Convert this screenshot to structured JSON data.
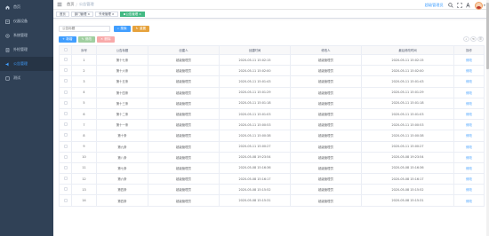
{
  "sidebar": {
    "items": [
      {
        "label": "首页",
        "icon": "dashboard-icon"
      },
      {
        "label": "仪器设备",
        "icon": "instrument-icon"
      },
      {
        "label": "系统管理",
        "icon": "system-icon"
      },
      {
        "label": "外检管理",
        "icon": "inspection-icon"
      },
      {
        "label": "公告管理",
        "icon": "notice-icon",
        "active": true
      },
      {
        "label": "测试",
        "icon": "test-icon"
      }
    ]
  },
  "navbar": {
    "breadcrumb": [
      "首页",
      "公告管理"
    ],
    "username": "超级管理员"
  },
  "tags": [
    {
      "label": "首页"
    },
    {
      "label": "部门管理"
    },
    {
      "label": "外来管理"
    },
    {
      "label": "公告管理",
      "active": true
    }
  ],
  "search": {
    "placeholder": "公告标题",
    "search_label": "搜索",
    "reset_label": "重置"
  },
  "actions": {
    "add_label": "新增",
    "edit_label": "修改",
    "delete_label": "删除"
  },
  "table": {
    "columns": [
      "",
      "序号",
      "公告标题",
      "创建人",
      "创建时间",
      "修改人",
      "最后修改时间",
      "操作"
    ],
    "rows": [
      {
        "no": "1",
        "title": "第十七条",
        "creator": "超级管理员",
        "created": "2020-05-11 15:02:15",
        "modifier": "超级管理员",
        "modified": "2020-05-11 15:02:15",
        "op": "修改"
      },
      {
        "no": "2",
        "title": "第十六条",
        "creator": "超级管理员",
        "created": "2020-05-11 15:02:00",
        "modifier": "超级管理员",
        "modified": "2020-05-11 15:02:00",
        "op": "修改"
      },
      {
        "no": "3",
        "title": "第十五条",
        "creator": "超级管理员",
        "created": "2020-05-11 15:01:43",
        "modifier": "超级管理员",
        "modified": "2020-05-11 15:01:43",
        "op": "修改"
      },
      {
        "no": "4",
        "title": "第十四条",
        "creator": "超级管理员",
        "created": "2020-05-11 15:01:29",
        "modifier": "超级管理员",
        "modified": "2020-05-11 15:01:29",
        "op": "修改"
      },
      {
        "no": "5",
        "title": "第十三条",
        "creator": "超级管理员",
        "created": "2020-05-11 15:01:18",
        "modifier": "超级管理员",
        "modified": "2020-05-11 15:01:18",
        "op": "修改"
      },
      {
        "no": "6",
        "title": "第十二条",
        "creator": "超级管理员",
        "created": "2020-05-11 15:01:03",
        "modifier": "超级管理员",
        "modified": "2020-05-11 15:01:03",
        "op": "修改"
      },
      {
        "no": "7",
        "title": "第十一条",
        "creator": "超级管理员",
        "created": "2020-05-11 15:00:53",
        "modifier": "超级管理员",
        "modified": "2020-05-11 15:00:53",
        "op": "修改"
      },
      {
        "no": "8",
        "title": "第十条",
        "creator": "超级管理员",
        "created": "2020-05-11 15:00:38",
        "modifier": "超级管理员",
        "modified": "2020-05-11 15:00:38",
        "op": "修改"
      },
      {
        "no": "9",
        "title": "第九条",
        "creator": "超级管理员",
        "created": "2020-05-11 15:00:27",
        "modifier": "超级管理员",
        "modified": "2020-05-11 15:00:27",
        "op": "修改"
      },
      {
        "no": "10",
        "title": "第八条",
        "creator": "超级管理员",
        "created": "2020-05-08 19:23:54",
        "modifier": "超级管理员",
        "modified": "2020-05-08 19:23:54",
        "op": "修改"
      },
      {
        "no": "11",
        "title": "第七条",
        "creator": "超级管理员",
        "created": "2020-05-08 15:16:36",
        "modifier": "超级管理员",
        "modified": "2020-05-08 15:16:36",
        "op": "修改"
      },
      {
        "no": "12",
        "title": "第六条",
        "creator": "超级管理员",
        "created": "2020-05-08 15:16:17",
        "modifier": "超级管理员",
        "modified": "2020-05-08 15:16:17",
        "op": "修改"
      },
      {
        "no": "13",
        "title": "第四条",
        "creator": "超级管理员",
        "created": "2020-05-08 15:15:52",
        "modifier": "超级管理员",
        "modified": "2020-05-08 15:15:52",
        "op": "修改"
      },
      {
        "no": "14",
        "title": "第四条",
        "creator": "超级管理员",
        "created": "2020-05-08 15:15:31",
        "modifier": "超级管理员",
        "modified": "2020-05-08 15:15:31",
        "op": "修改"
      }
    ]
  },
  "colors": {
    "sidebar_bg": "#304156",
    "accent": "#409eff",
    "active_tag": "#42b983",
    "reset": "#e6a23c"
  }
}
